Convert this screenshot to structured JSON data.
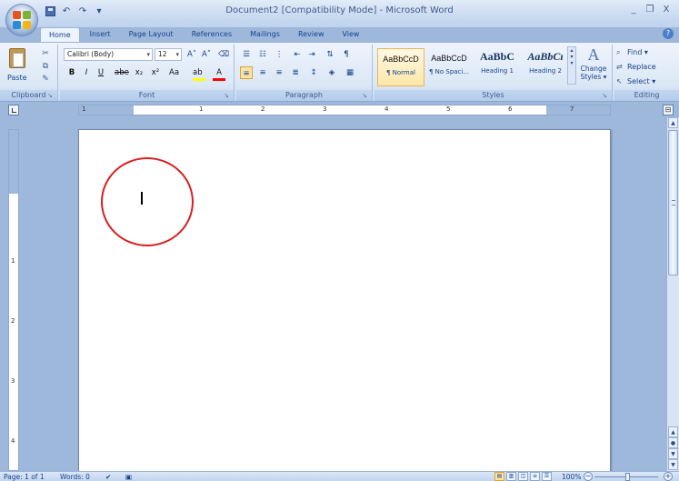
{
  "window": {
    "title": "Document2 [Compatibility Mode] - Microsoft Word",
    "minimize": "_",
    "restore": "❐",
    "close": "X"
  },
  "qat": {
    "undo": "↶",
    "redo": "↷",
    "customize": "▾"
  },
  "tabs": [
    "Home",
    "Insert",
    "Page Layout",
    "References",
    "Mailings",
    "Review",
    "View"
  ],
  "ribbon": {
    "clipboard": {
      "label": "Clipboard",
      "paste": "Paste"
    },
    "font": {
      "label": "Font",
      "font_name": "Calibri (Body)",
      "font_size": "12",
      "grow": "A˄",
      "shrink": "A˅",
      "clear": "⌫",
      "bold": "B",
      "italic": "I",
      "underline": "U",
      "strike": "abe",
      "subscript": "x₂",
      "superscript": "x²",
      "change_case": "Aa",
      "highlight": "ab",
      "font_color": "A"
    },
    "paragraph": {
      "label": "Paragraph"
    },
    "styles": {
      "label": "Styles",
      "items": [
        {
          "sample": "AaBbCcD",
          "name": "¶ Normal"
        },
        {
          "sample": "AaBbCcD",
          "name": "¶ No Spaci..."
        },
        {
          "sample": "AaBbC",
          "name": "Heading 1"
        },
        {
          "sample": "AaBbCı",
          "name": "Heading 2"
        }
      ],
      "change_styles": "Change Styles",
      "change_styles_line1": "Change",
      "change_styles_line2": "Styles ▾"
    },
    "editing": {
      "label": "Editing",
      "find": "Find ▾",
      "replace": "Replace",
      "select": "Select ▾"
    }
  },
  "ruler_numbers": [
    "1",
    "1",
    "2",
    "3",
    "4",
    "5",
    "6",
    "7"
  ],
  "vruler_numbers": [
    "1",
    "2",
    "3",
    "4"
  ],
  "status": {
    "page": "Page: 1 of 1",
    "words": "Words: 0",
    "zoom": "100%",
    "zoom_minus": "−",
    "zoom_plus": "+"
  },
  "colors": {
    "highlight": "#ffff00",
    "font_color": "#ff0000",
    "circle": "#d72020"
  }
}
